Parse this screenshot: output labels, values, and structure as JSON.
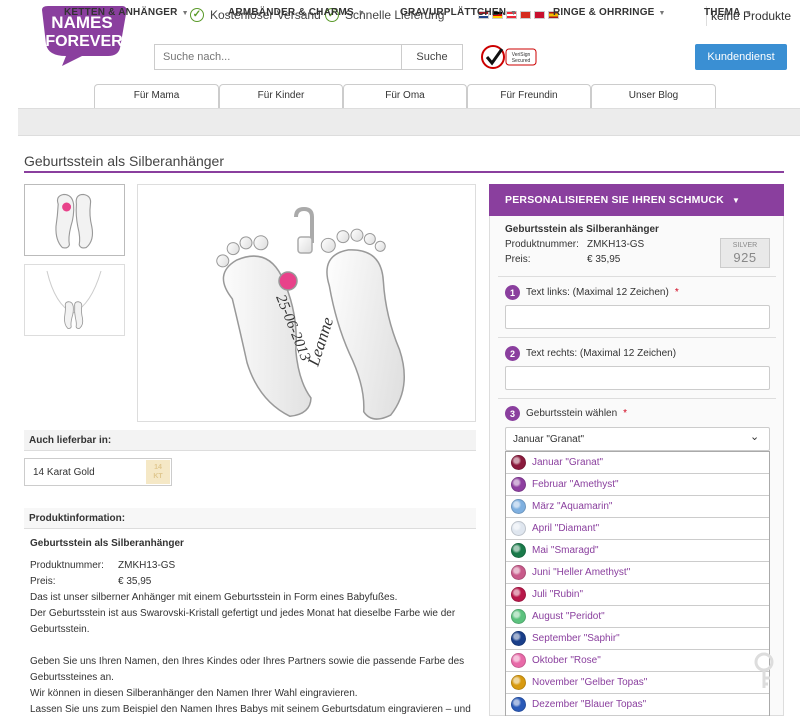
{
  "logo": {
    "line1": "NAMES",
    "line2": "FOREVER",
    "color": "#8a3f9e"
  },
  "usps": [
    "Kostenloser Versand",
    "Schnelle Lieferung"
  ],
  "flags": [
    "nl",
    "de",
    "at",
    "ch",
    "dk",
    "es"
  ],
  "cart": "keine Produkte",
  "search": {
    "placeholder": "Suche nach...",
    "button": "Suche"
  },
  "secured": {
    "line1": "VeriSign",
    "line2": "Secured"
  },
  "service_button": "Kundendienst",
  "tabs": [
    "Für Mama",
    "Für Kinder",
    "Für Oma",
    "Für Freundin",
    "Unser Blog"
  ],
  "nav": [
    "KETTEN & ANHÄNGER",
    "ARMBÄNDER & CHARMS",
    "GRAVURPLÄTTCHEN",
    "RINGE & OHRRINGE",
    "THEMA"
  ],
  "page_title": "Geburtsstein als Silberanhänger",
  "product_image": {
    "engraving_date": "25-06-2013",
    "engraving_name": "Leanne"
  },
  "also_available": {
    "heading": "Auch lieferbar in:",
    "option": "14 Karat Gold",
    "badge_top": "14",
    "badge_bottom": "KT"
  },
  "product_info": {
    "heading": "Produktinformation:",
    "name": "Geburtsstein als Silberanhänger",
    "number_label": "Produktnummer:",
    "number": "ZMKH13-GS",
    "price_label": "Preis:",
    "price": "€ 35,95",
    "p1": "Das ist unser silberner Anhänger mit einem Geburtsstein in Form eines Babyfußes.",
    "p2": "Der Geburtsstein ist aus Swarovski-Kristall gefertigt und jedes Monat hat dieselbe Farbe wie der Geburtsstein.",
    "p3": "Geben Sie uns Ihren Namen, den Ihres Kindes oder Ihres Partners sowie die passende Farbe des Geburtssteines an.",
    "p4": "Wir können in diesen Silberanhänger den Namen Ihrer Wahl eingravieren.",
    "p5": "Lassen Sie uns zum Beispiel den Namen Ihres Babys mit seinem Geburtsdatum eingravieren – und wir werden einen wunderschönen Anhänger daraus machen!"
  },
  "personalize": {
    "header": "PERSONALISIEREN SIE IHREN SCHMUCK",
    "name": "Geburtsstein als Silberanhänger",
    "number_label": "Produktnummer:",
    "number": "ZMKH13-GS",
    "price_label": "Preis:",
    "price": "€ 35,95",
    "silver_label": "SILVER",
    "silver_number": "925",
    "step1": {
      "num": "1",
      "label": "Text links: (Maximal 12 Zeichen)"
    },
    "step2": {
      "num": "2",
      "label": "Text rechts: (Maximal 12 Zeichen)"
    },
    "step3": {
      "num": "3",
      "label": "Geburtsstein wählen"
    },
    "selected": "Januar \"Granat\"",
    "options": [
      {
        "label": "Januar \"Granat\"",
        "color": "#8a1a3c"
      },
      {
        "label": "Februar \"Amethyst\"",
        "color": "#8e3fa0"
      },
      {
        "label": "März \"Aquamarin\"",
        "color": "#7fb0e0"
      },
      {
        "label": "April \"Diamant\"",
        "color": "#dfe6ef"
      },
      {
        "label": "Mai \"Smaragd\"",
        "color": "#1a7a4a"
      },
      {
        "label": "Juni \"Heller Amethyst\"",
        "color": "#c85a8a"
      },
      {
        "label": "Juli \"Rubin\"",
        "color": "#b8184a"
      },
      {
        "label": "August \"Peridot\"",
        "color": "#5cc27e"
      },
      {
        "label": "September \"Saphir\"",
        "color": "#1a3f8a"
      },
      {
        "label": "Oktober \"Rose\"",
        "color": "#e86aa8"
      },
      {
        "label": "November \"Gelber Topas\"",
        "color": "#d89a10"
      },
      {
        "label": "Dezember \"Blauer Topas\"",
        "color": "#2a5ab8"
      }
    ]
  }
}
